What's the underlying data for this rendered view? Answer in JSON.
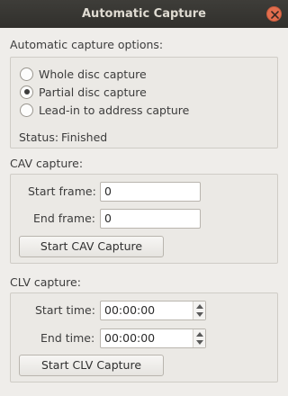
{
  "window": {
    "title": "Automatic Capture"
  },
  "automatic": {
    "group_label": "Automatic capture options:",
    "options": [
      {
        "label": "Whole disc capture",
        "checked": false
      },
      {
        "label": "Partial disc capture",
        "checked": true
      },
      {
        "label": "Lead-in to address capture",
        "checked": false
      }
    ],
    "status_label": "Status:",
    "status_value": "Finished"
  },
  "cav": {
    "group_label": "CAV capture:",
    "start_label": "Start frame:",
    "start_value": "0",
    "end_label": "End frame:",
    "end_value": "0",
    "button_label": "Start CAV Capture"
  },
  "clv": {
    "group_label": "CLV capture:",
    "start_label": "Start time:",
    "start_value": "00:00:00",
    "end_label": "End time:",
    "end_value": "00:00:00",
    "button_label": "Start CLV Capture"
  },
  "colors": {
    "titlebar": "#3e3d39",
    "close_button": "#e36e4e",
    "window_bg": "#efedea"
  },
  "icons": {
    "close": "close-icon",
    "spin_up": "chevron-up-icon",
    "spin_down": "chevron-down-icon"
  }
}
